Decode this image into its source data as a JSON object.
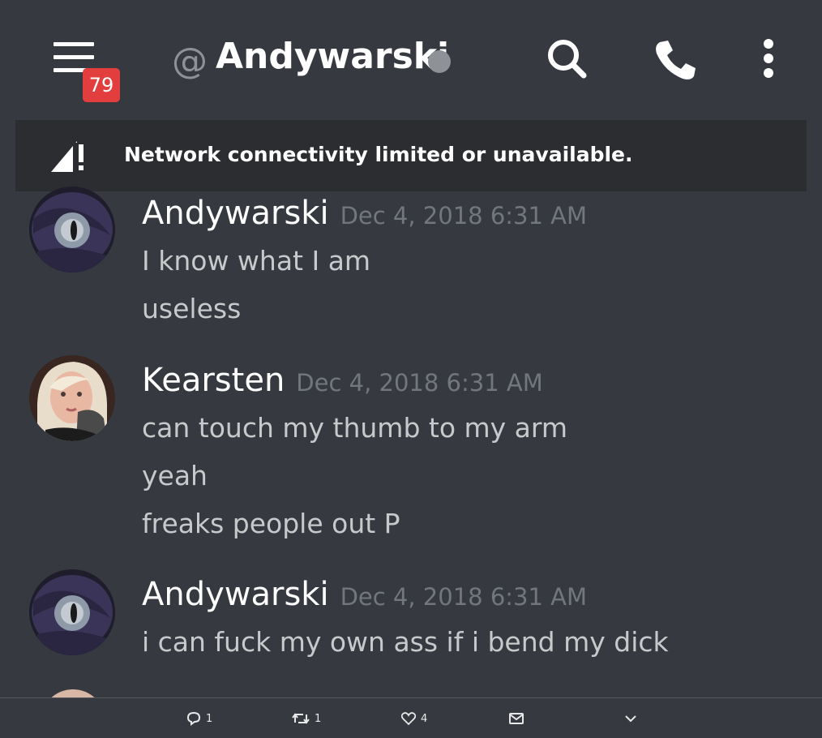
{
  "header": {
    "menu_icon": "hamburger-icon",
    "unread_badge": "79",
    "at_sign": "@",
    "title": "Andywarski",
    "status_color": "#8e9297",
    "search_icon": "search-icon",
    "call_icon": "phone-icon",
    "more_icon": "more-vertical-icon"
  },
  "banner": {
    "icon": "signal-warning-icon",
    "text": "Network connectivity limited or unavailable."
  },
  "messages": [
    {
      "author": "Andywarski",
      "timestamp": "Dec 4, 2018 6:31 AM",
      "lines": [
        "I know what I am",
        "useless"
      ]
    },
    {
      "author": "Kearsten",
      "timestamp": "Dec 4, 2018 6:31 AM",
      "lines": [
        "can touch my thumb to my arm",
        "yeah",
        "freaks people out P"
      ]
    },
    {
      "author": "Andywarski",
      "timestamp": "Dec 4, 2018 6:31 AM",
      "lines": [
        "i can fuck my own ass if i bend my dick"
      ]
    }
  ],
  "footer": {
    "reply_count": "1",
    "retweet_count": "1",
    "like_count": "4"
  },
  "colors": {
    "background": "#36393f",
    "banner": "#2b2d31",
    "badge": "#e23e3e"
  }
}
